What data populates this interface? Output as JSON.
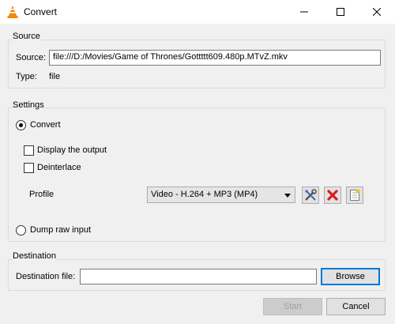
{
  "window": {
    "title": "Convert"
  },
  "source": {
    "group_title": "Source",
    "source_label": "Source:",
    "source_value": "file:///D:/Movies/Game of Thrones/Gottttt609.480p.MTvZ.mkv",
    "type_label": "Type:",
    "type_value": "file"
  },
  "settings": {
    "group_title": "Settings",
    "convert_label": "Convert",
    "convert_selected": true,
    "display_output_label": "Display the output",
    "display_output_checked": false,
    "deinterlace_label": "Deinterlace",
    "deinterlace_checked": false,
    "profile_label": "Profile",
    "profile_selected": "Video - H.264 + MP3 (MP4)",
    "dump_raw_label": "Dump raw input",
    "dump_raw_selected": false
  },
  "destination": {
    "group_title": "Destination",
    "file_label": "Destination file:",
    "file_value": "",
    "browse_label": "Browse"
  },
  "footer": {
    "start_label": "Start",
    "cancel_label": "Cancel"
  },
  "colors": {
    "accent": "#0078d7",
    "delete_red": "#d81e1e",
    "vlc_orange": "#f08a00"
  },
  "icons": {
    "app": "vlc-cone-icon",
    "edit_profile": "wrench-screwdriver-icon",
    "delete_profile": "red-x-icon",
    "new_profile": "new-document-icon"
  }
}
